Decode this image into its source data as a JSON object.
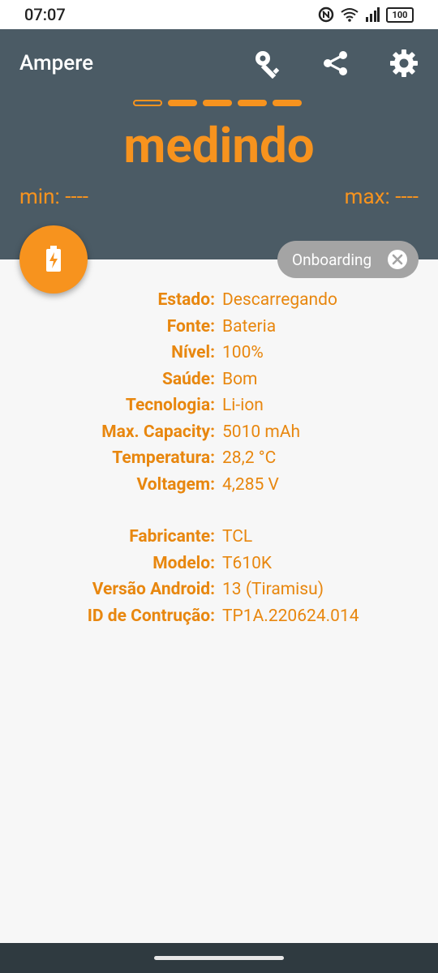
{
  "status": {
    "time": "07:07",
    "battery": "100",
    "network": "4G"
  },
  "header": {
    "title": "Ampere",
    "icons": [
      "key-icon",
      "share-icon",
      "settings-icon"
    ],
    "measuring": "medindo",
    "min": "min: ----",
    "max": "max: ----"
  },
  "chip": {
    "label": "Onboarding"
  },
  "info": {
    "battery": [
      {
        "label": "Estado:",
        "value": "Descarregando"
      },
      {
        "label": "Fonte:",
        "value": "Bateria"
      },
      {
        "label": "Nível:",
        "value": "100%"
      },
      {
        "label": "Saúde:",
        "value": "Bom"
      },
      {
        "label": "Tecnologia:",
        "value": "Li-ion"
      },
      {
        "label": "Max. Capacity:",
        "value": "5010 mAh"
      },
      {
        "label": "Temperatura:",
        "value": "28,2 °C"
      },
      {
        "label": "Voltagem:",
        "value": "4,285 V"
      }
    ],
    "device": [
      {
        "label": "Fabricante:",
        "value": "TCL"
      },
      {
        "label": "Modelo:",
        "value": "T610K"
      },
      {
        "label": "Versão Android:",
        "value": "13 (Tiramisu)"
      },
      {
        "label": "ID de Contrução:",
        "value": "TP1A.220624.014"
      }
    ]
  },
  "colors": {
    "accent": "#f7931e",
    "header": "#4b5b65"
  }
}
